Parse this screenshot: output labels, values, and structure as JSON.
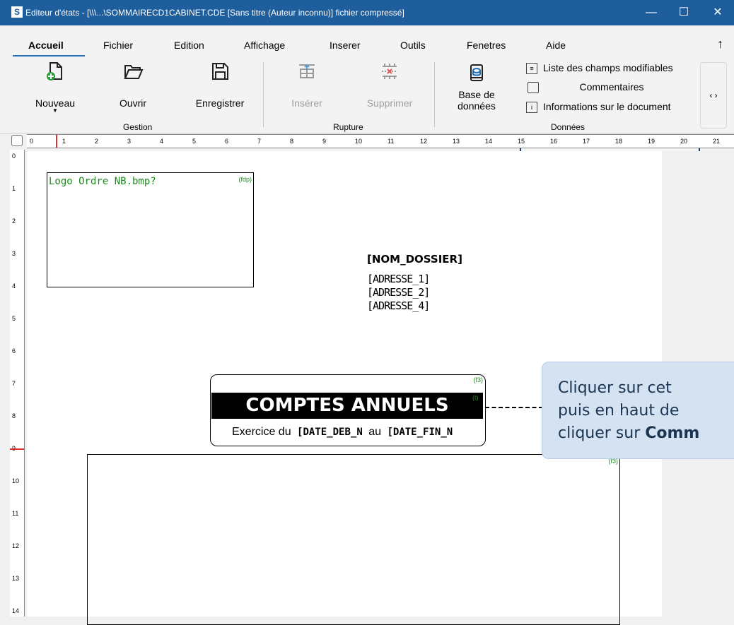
{
  "window": {
    "app_icon": "S",
    "title": "Editeur d'états - [\\\\\\...\\SOMMAIRECD1CABINET.CDE [Sans titre (Auteur inconnu)] fichier compressé]",
    "controls": {
      "minimize": "—",
      "maximize": "☐",
      "close": "✕"
    }
  },
  "menu": {
    "items": [
      "Accueil",
      "Fichier",
      "Edition",
      "Affichage",
      "Inserer",
      "Outils",
      "Fenetres",
      "Aide"
    ],
    "active": "Accueil",
    "collapse_icon": "↑"
  },
  "ribbon": {
    "gestion": {
      "label": "Gestion",
      "nouveau": "Nouveau",
      "ouvrir": "Ouvrir",
      "enregistrer": "Enregistrer"
    },
    "rupture": {
      "label": "Rupture",
      "inserer": "Insérer",
      "supprimer": "Supprimer"
    },
    "donnees": {
      "label": "Données",
      "base_line1": "Base de",
      "base_line2": "données",
      "liste_champs": "Liste des champs modifiables",
      "commentaires": "Commentaires",
      "informations": "Informations sur le document"
    },
    "scroll_arrows": "‹ ›"
  },
  "ruler": {
    "h_ticks": [
      "0",
      "1",
      "2",
      "3",
      "4",
      "5",
      "6",
      "7",
      "8",
      "9",
      "10",
      "11",
      "12",
      "13",
      "14",
      "15",
      "16",
      "17",
      "18",
      "19",
      "20",
      "21"
    ],
    "v_ticks": [
      "0",
      "1",
      "2",
      "3",
      "4",
      "5",
      "6",
      "7",
      "8",
      "9",
      "10",
      "11",
      "12",
      "13",
      "14"
    ]
  },
  "document": {
    "logo_text": "Logo Ordre NB.bmp?",
    "logo_tag": "(fdp)",
    "nom_dossier": "[NOM_DOSSIER]",
    "adresse1": "[ADRESSE_1]",
    "adresse2": "[ADRESSE_2]",
    "adresse4": "[ADRESSE_4]",
    "tag_f3": "(f3)",
    "tag_t": "(t)",
    "title": "COMPTES ANNUELS",
    "exercice_label": "Exercice du",
    "date_deb": "[DATE_DEB_N",
    "au_label": "au",
    "date_fin": "[DATE_FIN_N",
    "bottom_tag": "(f3)"
  },
  "callout": {
    "line1": "Cliquer sur cet",
    "line2": "puis en haut de",
    "line3_prefix": "cliquer sur ",
    "line3_bold": "Comm"
  }
}
